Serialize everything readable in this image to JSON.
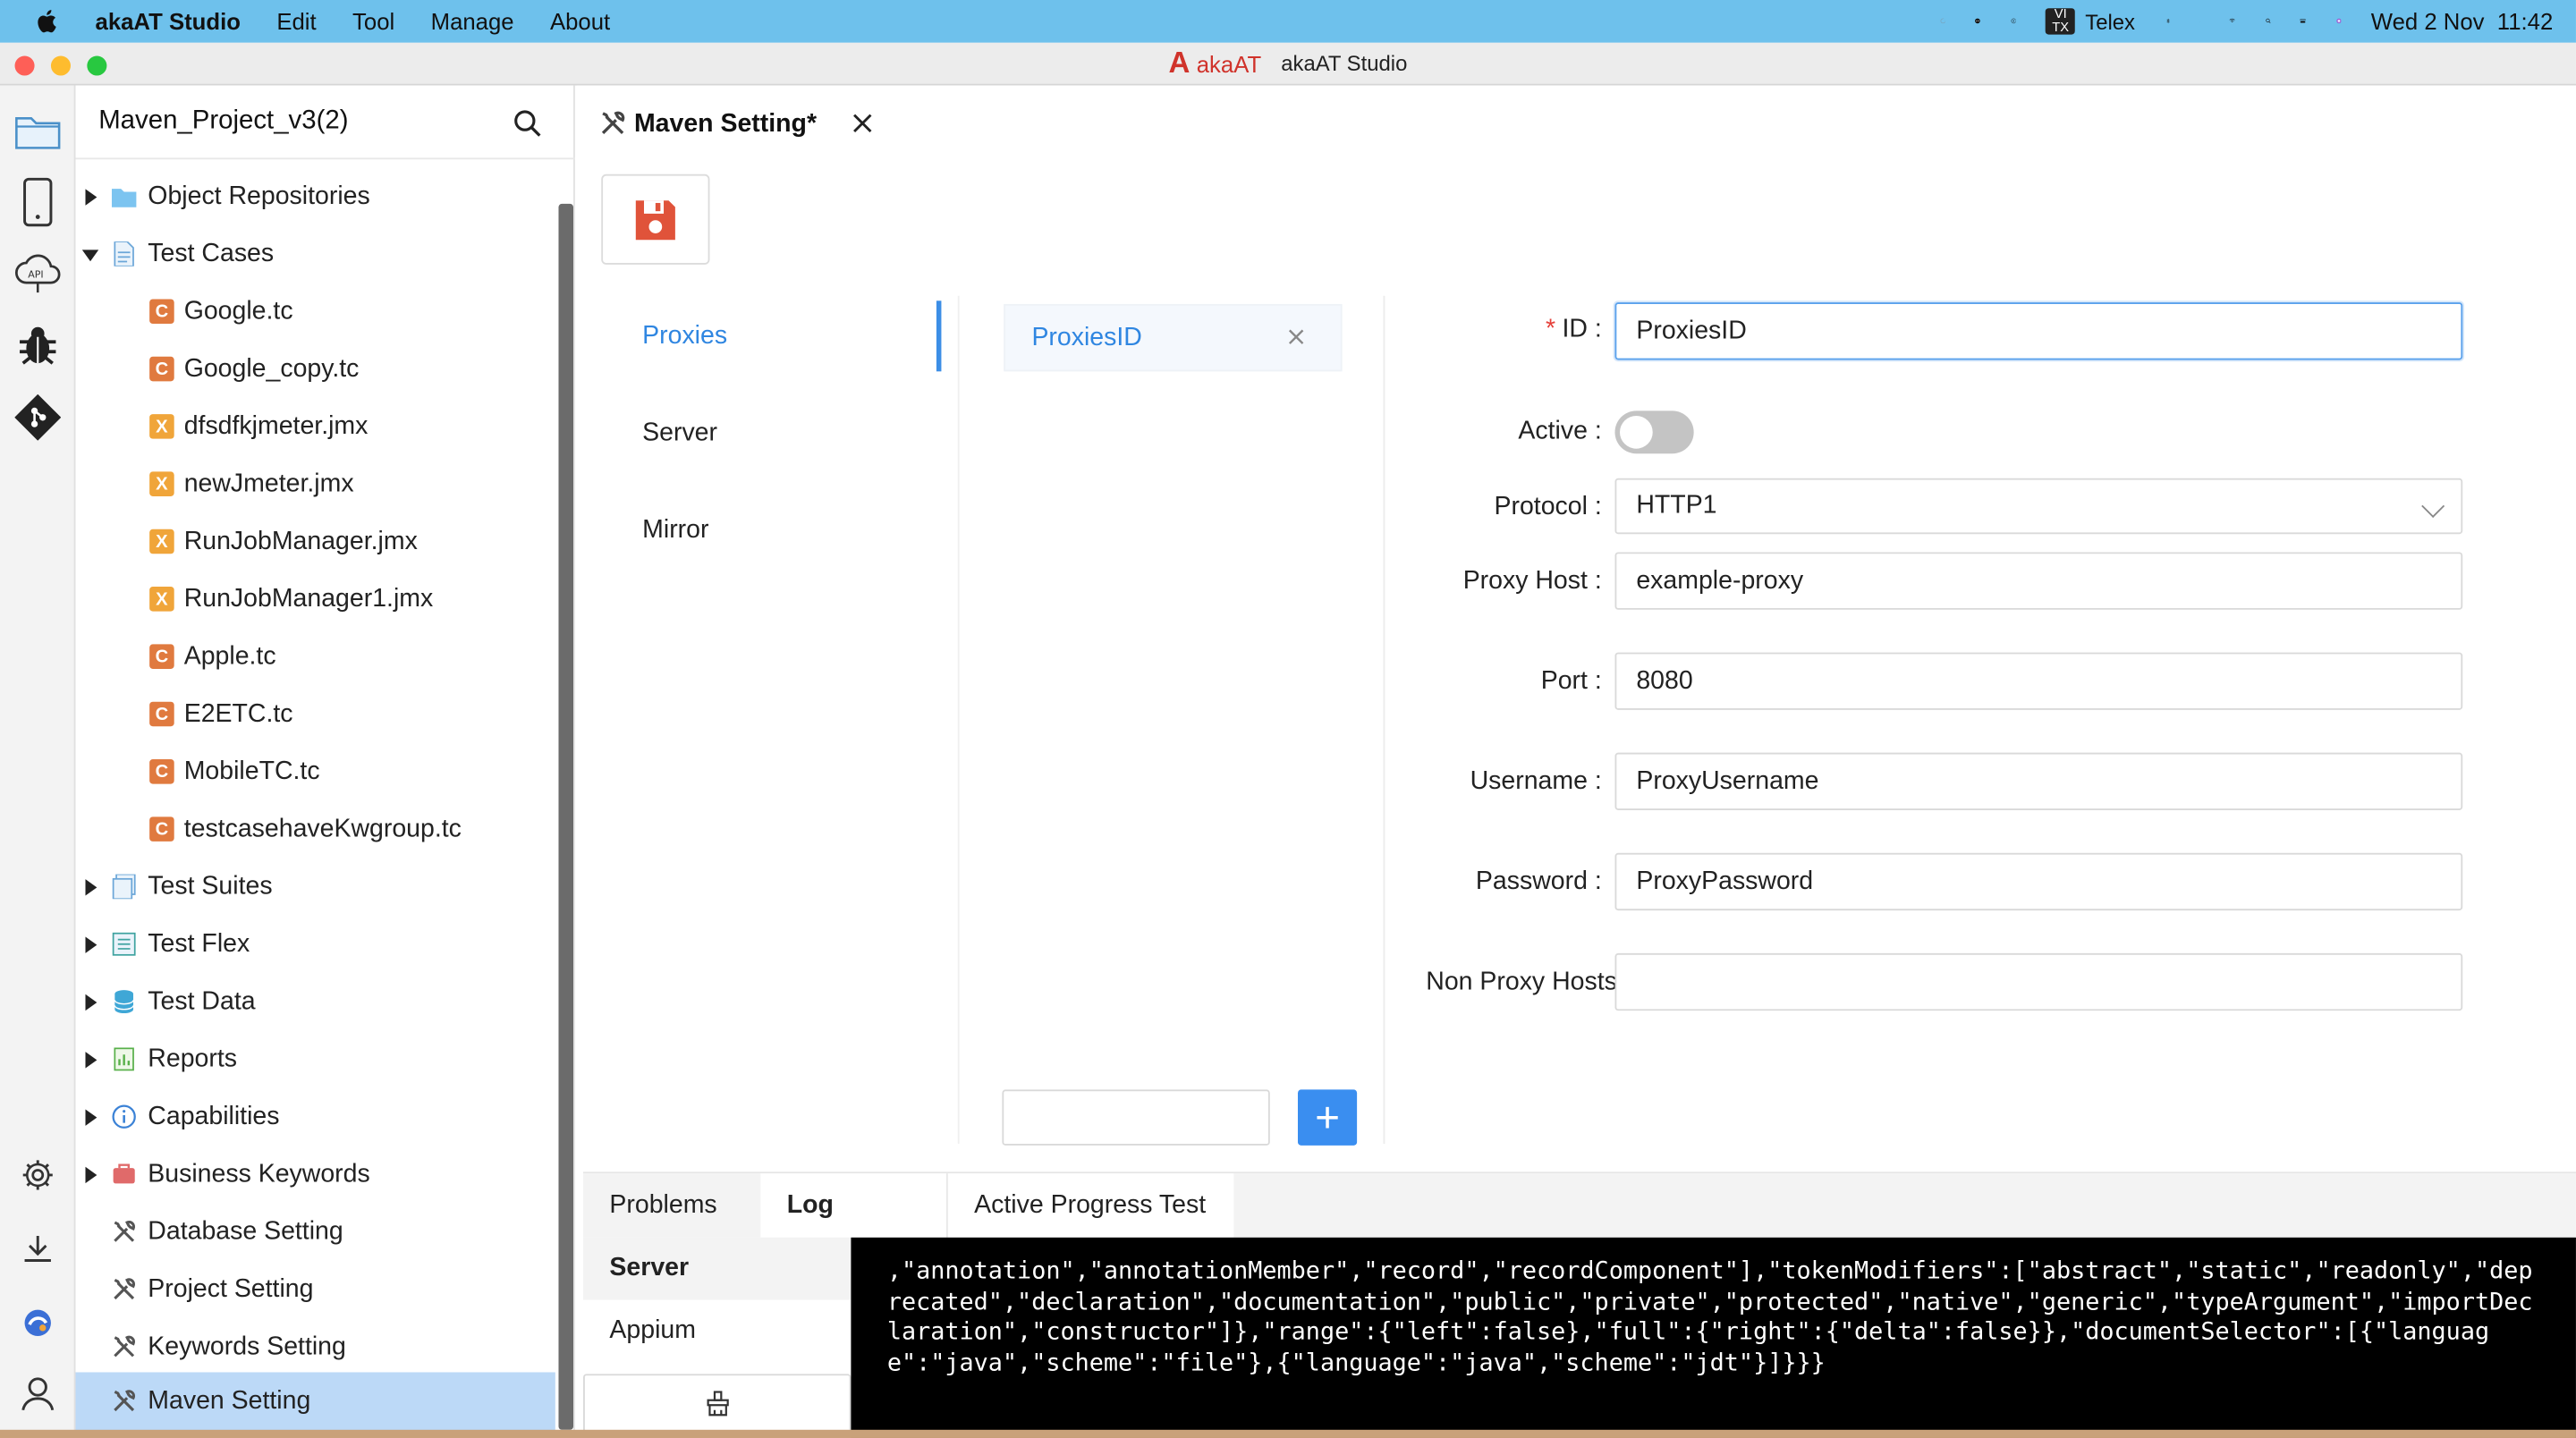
{
  "menubar": {
    "app_name": "akaAT Studio",
    "menus": [
      "Edit",
      "Tool",
      "Manage",
      "About"
    ],
    "status_app": "Telex",
    "datetime": "Wed 2 Nov  11:42"
  },
  "window": {
    "title": "akaAT Studio",
    "logo_text": "akaAT",
    "traffic_colors": [
      "#fe5f57",
      "#febc2e",
      "#28c840"
    ]
  },
  "explorer": {
    "project_name": "Maven_Project_v3(2)",
    "items": [
      {
        "label": "Object Repositories",
        "type": "folder",
        "expanded": false
      },
      {
        "label": "Test Cases",
        "type": "testcases",
        "expanded": true
      },
      {
        "label": "Google.tc",
        "type": "tc"
      },
      {
        "label": "Google_copy.tc",
        "type": "tc"
      },
      {
        "label": "dfsdfkjmeter.jmx",
        "type": "jmx"
      },
      {
        "label": "newJmeter.jmx",
        "type": "jmx"
      },
      {
        "label": "RunJobManager.jmx",
        "type": "jmx"
      },
      {
        "label": "RunJobManager1.jmx",
        "type": "jmx"
      },
      {
        "label": "Apple.tc",
        "type": "tc"
      },
      {
        "label": "E2ETC.tc",
        "type": "tc"
      },
      {
        "label": "MobileTC.tc",
        "type": "tc"
      },
      {
        "label": "testcasehaveKwgroup.tc",
        "type": "tc"
      },
      {
        "label": "Test Suites",
        "type": "suites",
        "expanded": false
      },
      {
        "label": "Test Flex",
        "type": "flex",
        "expanded": false
      },
      {
        "label": "Test Data",
        "type": "data",
        "expanded": false
      },
      {
        "label": "Reports",
        "type": "reports",
        "expanded": false
      },
      {
        "label": "Capabilities",
        "type": "capabilities",
        "expanded": false
      },
      {
        "label": "Business Keywords",
        "type": "business",
        "expanded": false
      },
      {
        "label": "Database Setting",
        "type": "setting"
      },
      {
        "label": "Project Setting",
        "type": "setting"
      },
      {
        "label": "Keywords Setting",
        "type": "setting"
      },
      {
        "label": "Maven Setting",
        "type": "setting",
        "selected": true
      }
    ],
    "tc_letter": "C",
    "jmx_letter": "X"
  },
  "editor": {
    "tab_label": "Maven Setting*",
    "nav": [
      "Proxies",
      "Server",
      "Mirror"
    ],
    "active_nav": "Proxies",
    "proxy_items": [
      "ProxiesID"
    ],
    "new_proxy_value": "",
    "add_label": "+"
  },
  "form": {
    "required_mark": "*",
    "id_label": "ID",
    "id_value": "ProxiesID",
    "active_label": "Active",
    "active_value": false,
    "protocol_label": "Protocol",
    "protocol_value": "HTTP1",
    "host_label": "Proxy Host",
    "host_value": "example-proxy",
    "port_label": "Port",
    "port_value": "8080",
    "username_label": "Username",
    "username_value": "ProxyUsername",
    "password_label": "Password",
    "password_value": "ProxyPassword",
    "nonproxy_label": "Non Proxy Hosts",
    "nonproxy_value": "",
    "colon": ":"
  },
  "bottom": {
    "tabs": [
      "Problems",
      "Log",
      "Active Progress Test"
    ],
    "active_tab": "Log",
    "log_sources": [
      "Server",
      "Appium"
    ],
    "active_source": "Server",
    "console_text": ",\"annotation\",\"annotationMember\",\"record\",\"recordComponent\"],\"tokenModifiers\":[\"abstract\",\"static\",\"readonly\",\"deprecated\",\"declaration\",\"documentation\",\"public\",\"private\",\"protected\",\"native\",\"generic\",\"typeArgument\",\"importDeclaration\",\"constructor\"]},\"range\":{\"left\":false},\"full\":{\"right\":{\"delta\":false}},\"documentSelector\":[{\"language\":\"java\",\"scheme\":\"file\"},{\"language\":\"java\",\"scheme\":\"jdt\"}]}}}"
  },
  "colors": {
    "menubar": "#6ec1ec",
    "accent": "#3a8ef0",
    "link": "#2f86e1",
    "selected_row": "#bcd9f7",
    "save_icon": "#e0533a",
    "required": "#e5413a"
  }
}
